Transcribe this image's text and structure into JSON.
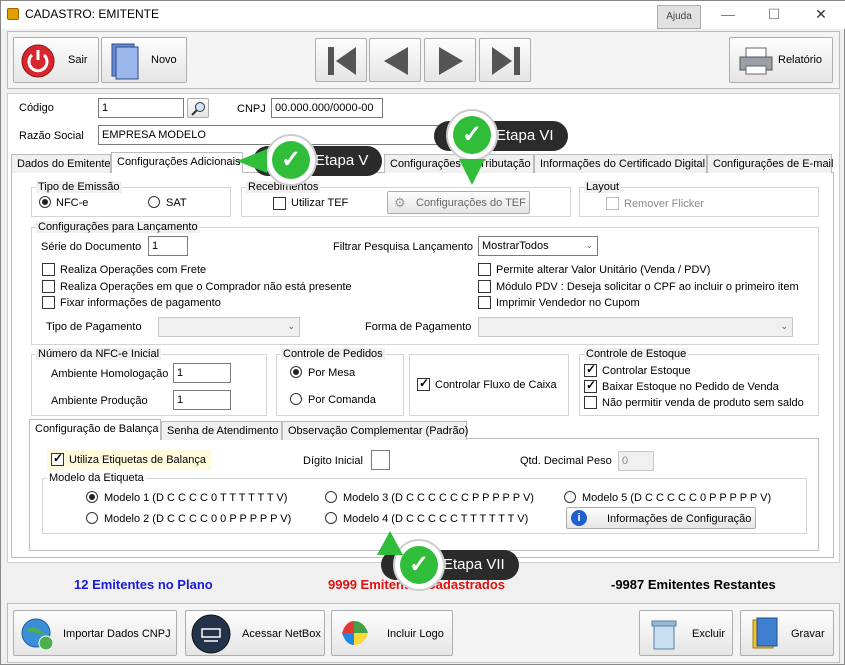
{
  "window": {
    "title": "CADASTRO: EMITENTE",
    "help_label": "Ajuda",
    "minimize": "—",
    "maximize": "☐",
    "close": "✕"
  },
  "toolbar": {
    "exit_label": "Sair",
    "new_label": "Novo",
    "report_label": "Relatório"
  },
  "header": {
    "code_label": "Código",
    "code_value": "1",
    "cnpj_label": "CNPJ",
    "cnpj_value": "00.000.000/0000-00",
    "razao_label": "Razão Social",
    "razao_value": "EMPRESA MODELO"
  },
  "tabs": {
    "t1": "Dados do Emitente",
    "t2": "Configurações Adicionais",
    "t3": "Configurações de Tributação",
    "t4": "Informações do Certificado Digital",
    "t5": "Configurações de E-mail"
  },
  "emissao": {
    "title": "Tipo de Emissão",
    "nfce": "NFC-e",
    "sat": "SAT"
  },
  "recebimentos": {
    "title": "Recebimentos",
    "utilizar_tef": "Utilizar TEF",
    "config_tef": "Configurações do TEF"
  },
  "layout": {
    "title": "Layout",
    "remover_flicker": "Remover Flicker"
  },
  "lancamento": {
    "title": "Configurações para Lançamento",
    "serie_label": "Série do Documento",
    "serie_value": "1",
    "filtrar_label": "Filtrar Pesquisa Lançamento",
    "filtrar_value": "MostrarTodos",
    "frete": "Realiza Operações com Frete",
    "comprador": "Realiza Operações em que o Comprador não está presente",
    "fixar_pagamento": "Fixar informações de pagamento",
    "permite_alterar": "Permite alterar Valor Unitário (Venda / PDV)",
    "modulo_pdv": "Módulo PDV : Deseja solicitar o CPF ao incluir o primeiro item",
    "imprimir_vendedor": "Imprimir Vendedor no Cupom",
    "tipo_pagamento_label": "Tipo de Pagamento",
    "forma_pagamento_label": "Forma de Pagamento"
  },
  "numero": {
    "title": "Número da NFC-e Inicial",
    "homolog_label": "Ambiente Homologação",
    "homolog_value": "1",
    "producao_label": "Ambiente Produção",
    "producao_value": "1"
  },
  "pedidos": {
    "title": "Controle de Pedidos",
    "por_mesa": "Por Mesa",
    "por_comanda": "Por Comanda"
  },
  "fluxo": {
    "label": "Controlar Fluxo de Caixa"
  },
  "estoque": {
    "title": "Controle de Estoque",
    "controlar": "Controlar Estoque",
    "baixar": "Baixar Estoque no Pedido de Venda",
    "nao_permitir": "Não permitir venda de produto sem saldo"
  },
  "subtabs": {
    "s1": "Configuração de Balança",
    "s2": "Senha de Atendimento",
    "s3": "Observação Complementar (Padrão)"
  },
  "balanca": {
    "utiliza": "Utiliza Etiquetas de Balança",
    "digito_label": "Dígito Inicial",
    "digito_value": "",
    "qtd_label": "Qtd. Decimal Peso",
    "qtd_value": "0",
    "modelo_title": "Modelo da Etiqueta",
    "m1": "Modelo 1 (D C C C C 0 T T T T T T V)",
    "m2": "Modelo 2 (D C C C C 0 0 P P P P P V)",
    "m3": "Modelo 3 (D C C C C C C P P P P P V)",
    "m4": "Modelo 4 (D C C C C C T T T T T T V)",
    "m5": "Modelo 5 (D C C C C C 0 P P P P P V)",
    "info_config": "Informações de Configuração"
  },
  "status": {
    "plano": "12 Emitentes no Plano",
    "cadastrados": "9999 Emitentes Cadastrados",
    "restantes": "-9987 Emitentes Restantes",
    "plano_color": "#1a1ad8",
    "cadastrados_color": "#e01010"
  },
  "bottom": {
    "importar": "Importar Dados CNPJ",
    "netbox": "Acessar NetBox",
    "logo": "Incluir Logo",
    "excluir": "Excluir",
    "gravar": "Gravar"
  },
  "callouts": {
    "v": "Etapa V",
    "vi": "Etapa VI",
    "vii": "Etapa VII"
  }
}
